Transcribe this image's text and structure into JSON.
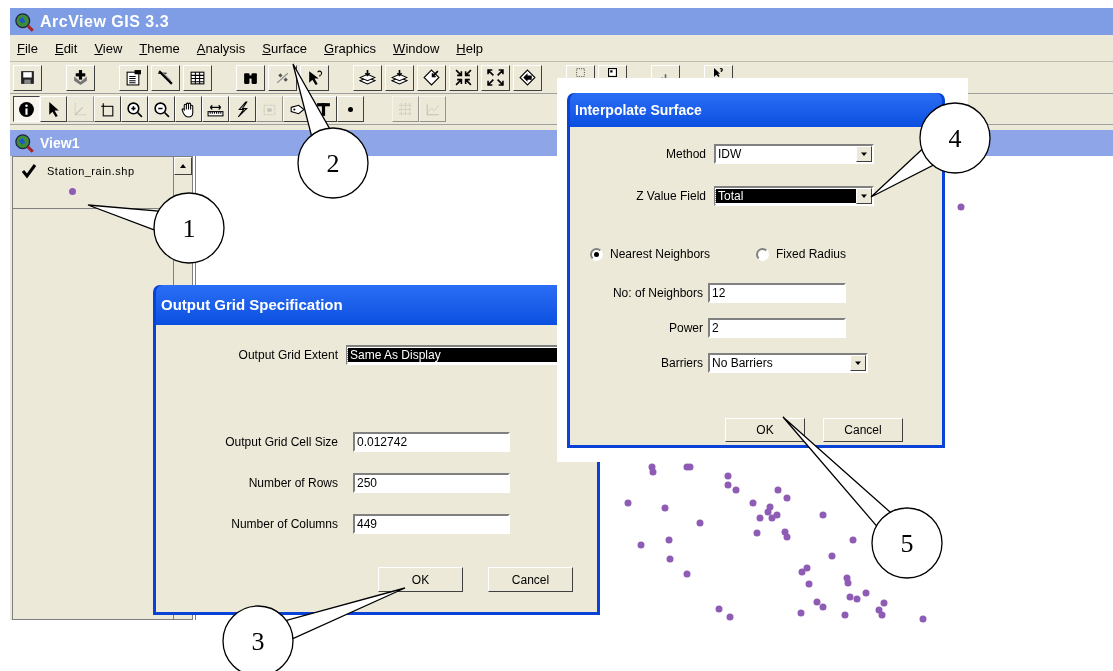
{
  "window": {
    "title": "ArcView GIS 3.3"
  },
  "menu": [
    "File",
    "Edit",
    "View",
    "Theme",
    "Analysis",
    "Surface",
    "Graphics",
    "Window",
    "Help"
  ],
  "toolbar_1": [
    {
      "kind": "save"
    },
    {
      "kind": "spacer"
    },
    {
      "kind": "add"
    },
    {
      "kind": "spacer"
    },
    {
      "kind": "properties"
    },
    {
      "kind": "legend"
    },
    {
      "kind": "table"
    },
    {
      "kind": "spacer"
    },
    {
      "kind": "find"
    },
    {
      "kind": "query"
    },
    {
      "kind": "help_tool"
    },
    {
      "kind": "spacer"
    },
    {
      "kind": "layers"
    },
    {
      "kind": "layers"
    },
    {
      "kind": "zoom_theme"
    },
    {
      "kind": "shrink"
    },
    {
      "kind": "expand"
    },
    {
      "kind": "previous"
    },
    {
      "kind": "spacer"
    },
    {
      "kind": "frame_dotted"
    },
    {
      "kind": "frame"
    },
    {
      "kind": "spacer"
    },
    {
      "kind": "chart"
    },
    {
      "kind": "spacer"
    },
    {
      "kind": "help"
    }
  ],
  "toolbar_2": [
    {
      "kind": "info",
      "selected": true,
      "disabled": false
    },
    {
      "kind": "pointer",
      "selected": false,
      "disabled": false
    },
    {
      "kind": "vertex",
      "selected": false,
      "disabled": true
    },
    {
      "kind": "select_box",
      "selected": false,
      "disabled": false
    },
    {
      "kind": "zoom_in",
      "selected": false,
      "disabled": false
    },
    {
      "kind": "zoom_out",
      "selected": false,
      "disabled": false
    },
    {
      "kind": "pan",
      "selected": false,
      "disabled": false
    },
    {
      "kind": "measure",
      "selected": false,
      "disabled": false
    },
    {
      "kind": "hotlink",
      "selected": false,
      "disabled": false
    },
    {
      "kind": "area_select",
      "selected": false,
      "disabled": true
    },
    {
      "kind": "label",
      "selected": false,
      "disabled": false
    },
    {
      "kind": "text",
      "selected": false,
      "disabled": false
    },
    {
      "kind": "point",
      "selected": false,
      "disabled": false
    },
    {
      "kind": "spacer"
    },
    {
      "kind": "snap",
      "selected": false,
      "disabled": true
    },
    {
      "kind": "graph",
      "selected": false,
      "disabled": true
    }
  ],
  "view": {
    "title": "View1",
    "legend": [
      {
        "name": "Station_rain.shp",
        "checked": true,
        "color": "#8e5cb5"
      }
    ]
  },
  "output_grid_dialog": {
    "title": "Output Grid Specification",
    "extent": {
      "label": "Output Grid Extent",
      "value": "Same As Display",
      "focused": true
    },
    "fields": [
      {
        "label": "Output Grid Cell Size",
        "value": "0.012742"
      },
      {
        "label": "Number of Rows",
        "value": "250"
      },
      {
        "label": "Number of Columns",
        "value": "449"
      }
    ],
    "buttons": [
      "OK",
      "Cancel"
    ]
  },
  "interpolate_dialog": {
    "title": "Interpolate Surface",
    "dropdowns": [
      {
        "label": "Method",
        "value": "IDW",
        "focused": false
      },
      {
        "label": "Z Value Field",
        "value": "Total",
        "focused": true
      }
    ],
    "radios": [
      {
        "label": "Nearest Neighbors",
        "selected": true
      },
      {
        "label": "Fixed Radius",
        "selected": false
      }
    ],
    "fields": [
      {
        "kind": "text",
        "label": "No: of Neighbors",
        "value": "12"
      },
      {
        "kind": "text",
        "label": "Power",
        "value": "2"
      },
      {
        "kind": "dropdown",
        "label": "Barriers",
        "value": "No Barriers"
      }
    ],
    "buttons": [
      "OK",
      "Cancel"
    ]
  },
  "callouts": [
    "1",
    "2",
    "3",
    "4",
    "5"
  ]
}
